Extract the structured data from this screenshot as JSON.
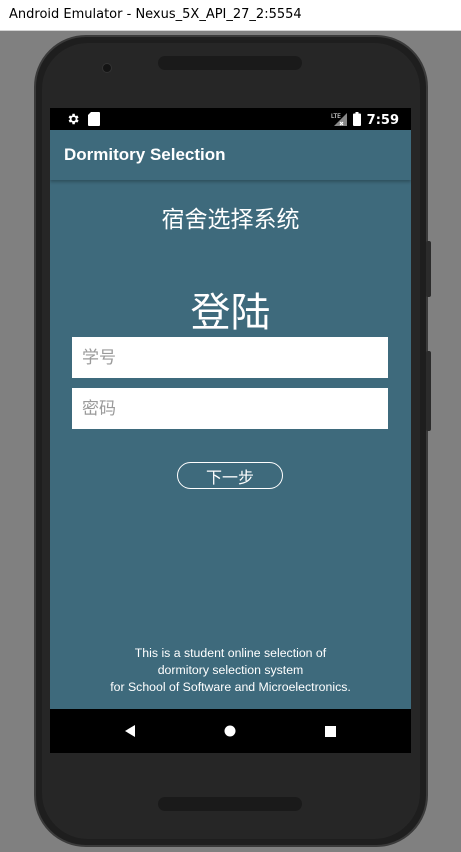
{
  "window": {
    "title": "Android Emulator - Nexus_5X_API_27_2:5554"
  },
  "statusbar": {
    "time": "7:59",
    "left_icons": [
      "settings-icon",
      "sd-card-icon"
    ],
    "right_icons": [
      "signal-icon",
      "battery-icon"
    ]
  },
  "appbar": {
    "title": "Dormitory Selection"
  },
  "main": {
    "system_title": "宿舍选择系统",
    "login_title": "登陆",
    "student_id": {
      "value": "",
      "placeholder": "学号"
    },
    "password": {
      "value": "",
      "placeholder": "密码"
    },
    "next_label": "下一步",
    "footer_lines": [
      "This is a student online selection of",
      "dormitory selection system",
      "for School of Software and Microelectronics."
    ]
  },
  "navbar": {
    "icons": [
      "back-icon",
      "home-icon",
      "recents-icon"
    ]
  },
  "colors": {
    "background": "#3e6a7c",
    "statusbar": "#000000",
    "text": "#ffffff"
  }
}
